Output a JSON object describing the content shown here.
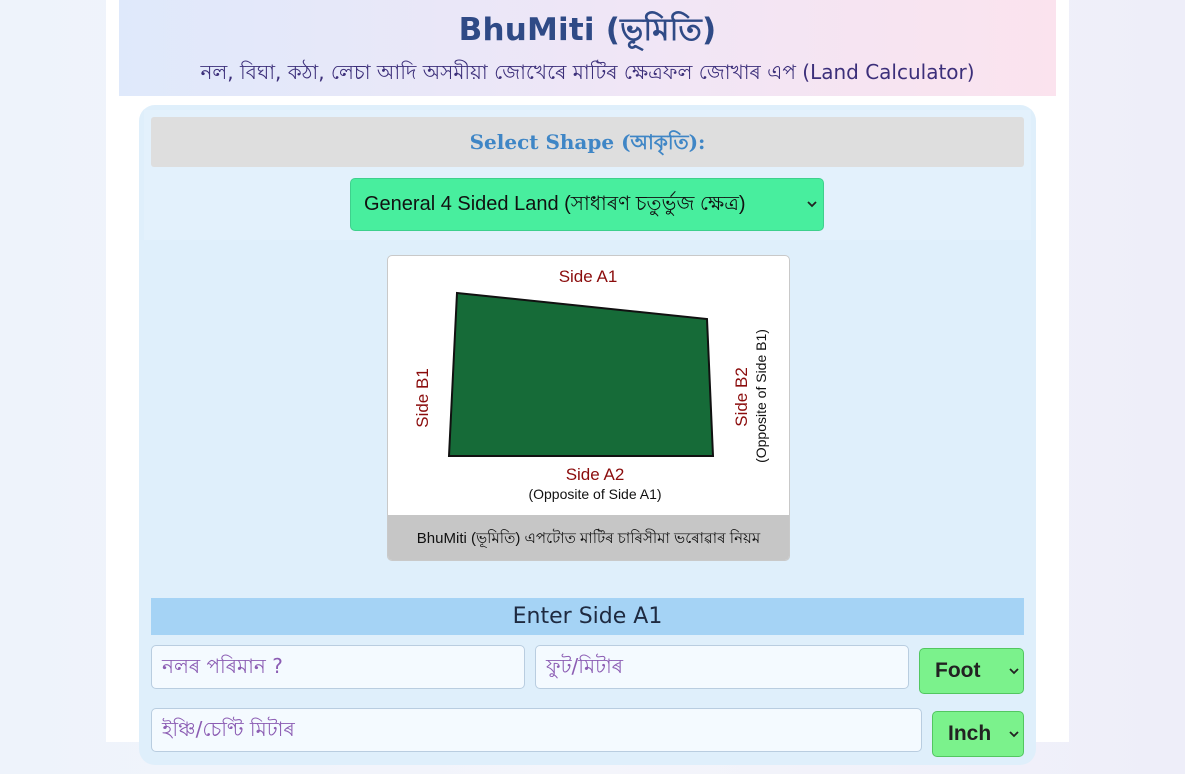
{
  "header": {
    "title": "BhuMiti (ভূমিতি)",
    "subtitle": "নল, বিঘা, কঠা, লেচা আদি অসমীয়া জোখেৰে মাটিৰ ক্ষেত্ৰফল জোখাৰ এপ (Land Calculator)"
  },
  "shape": {
    "label": "Select Shape (আকৃতি):",
    "selected": "General 4 Sided Land (সাধাৰণ চতুৰ্ভুজ ক্ষেত্ৰ)"
  },
  "figure": {
    "side_a1": "Side A1",
    "side_a2": "Side A2",
    "side_a2_note": "(Opposite of Side A1)",
    "side_b1": "Side B1",
    "side_b2": "Side B2",
    "side_b2_note": "(Opposite of Side B1)",
    "caption": "BhuMiti (ভূমিতি) এপটোত মাটিৰ চাৰিসীমা ভৰোৱাৰ নিয়ম"
  },
  "side_a1": {
    "heading": "Enter Side A1",
    "nal_placeholder": "নলৰ পৰিমান ?",
    "foot_placeholder": "ফুট/মিটাৰ",
    "foot_unit": "Foot",
    "inch_placeholder": "ইঞ্চি/চেণ্টি মিটাৰ",
    "inch_unit": "Inch"
  },
  "colors": {
    "title": "#2f4a86",
    "select_bg": "#48ee9e",
    "unit_bg": "#7bf28c",
    "shape_fill": "#166b38",
    "side_label": "#8b0c0c",
    "section_head": "#a5d3f5"
  },
  "icons": {
    "select_chevron": "chevron-down-icon"
  }
}
